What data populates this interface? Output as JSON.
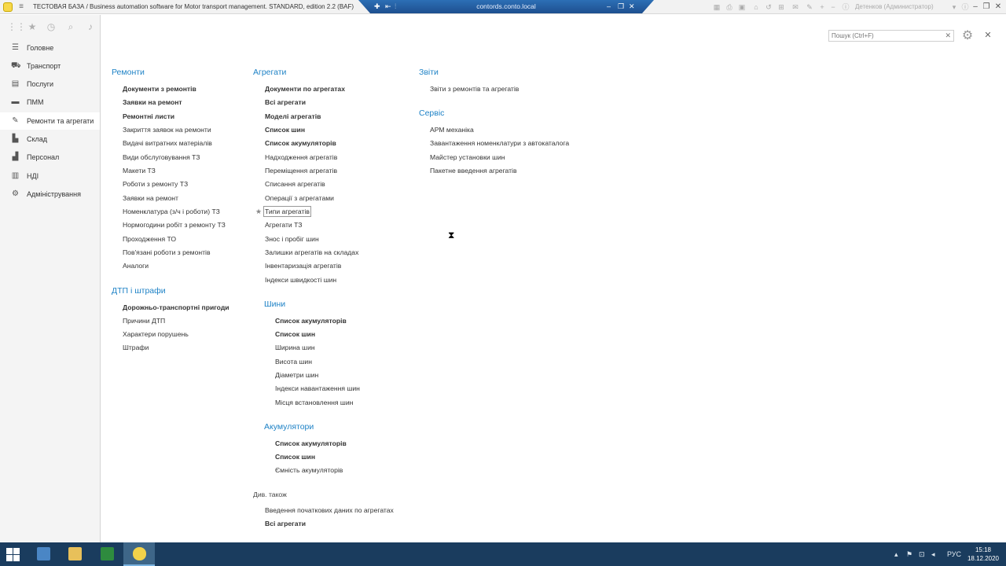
{
  "titlebar": {
    "title": "ТЕСТОВАЯ БАЗА / Business automation software for Motor transport management. STANDARD, edition 2.2  (BAF)",
    "user": "Детенков (Администратор)"
  },
  "rdp": {
    "host": "contords.conto.local"
  },
  "search": {
    "placeholder": "Пошук (Ctrl+F)",
    "value": ""
  },
  "sidebar": {
    "items": [
      {
        "label": "Головне",
        "icon": "menu-lines-icon"
      },
      {
        "label": "Транспорт",
        "icon": "truck-icon"
      },
      {
        "label": "Послуги",
        "icon": "services-icon"
      },
      {
        "label": "ПММ",
        "icon": "fuel-icon"
      },
      {
        "label": "Ремонти та агрегати",
        "icon": "wrench-icon"
      },
      {
        "label": "Склад",
        "icon": "warehouse-icon"
      },
      {
        "label": "Персонал",
        "icon": "personnel-icon"
      },
      {
        "label": "НДІ",
        "icon": "reference-icon"
      },
      {
        "label": "Адміністрування",
        "icon": "gear-icon"
      }
    ],
    "active_index": 4
  },
  "col1": {
    "repairs": {
      "title": "Ремонти",
      "items": [
        "Документи з ремонтів",
        "Заявки на ремонт",
        "Ремонтні листи",
        "Закриття заявок на ремонти",
        "Видачі витратних матеріалів",
        "Види обслуговування ТЗ",
        "Макети ТЗ",
        "Роботи з ремонту ТЗ",
        "Заявки на ремонт",
        "Номенклатура (з/ч і роботи) ТЗ",
        "Нормогодини робіт з ремонту ТЗ",
        "Проходження ТО",
        "Пов'язані роботи з ремонтів",
        "Аналоги"
      ]
    },
    "accidents": {
      "title": "ДТП і штрафи",
      "items": [
        "Дорожньо-транспортні пригоди",
        "Причини ДТП",
        "Характери порушень",
        "Штрафи"
      ]
    }
  },
  "col2": {
    "units": {
      "title": "Агрегати",
      "items": [
        "Документи по агрегатах",
        "Всі агрегати",
        "Моделі агрегатів",
        "Список шин",
        "Список акумуляторів",
        "Надходження агрегатів",
        "Переміщення агрегатів",
        "Списання агрегатів",
        "Операції з агрегатами",
        "Типи агрегатів",
        "Агрегати ТЗ",
        "Знос і пробіг шин",
        "Залишки агрегатів на складах",
        "Інвентаризація агрегатів",
        "Індекси швидкості шин"
      ]
    },
    "tires": {
      "title": "Шини",
      "items": [
        "Список акумуляторів",
        "Список шин",
        "Ширина шин",
        "Висота шин",
        "Діаметри шин",
        "Індекси навантаження шин",
        "Місця встановлення шин"
      ]
    },
    "batteries": {
      "title": "Акумулятори",
      "items": [
        "Список акумуляторів",
        "Список шин",
        "Ємність акумуляторів"
      ]
    },
    "see_also": {
      "title": "Див. також",
      "items": [
        "Введення початкових даних по агрегатах",
        "Всі агрегати"
      ]
    }
  },
  "col3": {
    "reports": {
      "title": "Звіти",
      "items": [
        "Звіти з ремонтів та агрегатів"
      ]
    },
    "service": {
      "title": "Сервіс",
      "items": [
        "АРМ механіка",
        "Завантаження номенклатури з автокаталога",
        "Майстер установки шин",
        "Пакетне введення агрегатів"
      ]
    }
  },
  "taskbar": {
    "language": "РУС",
    "time": "15:18",
    "date": "18.12.2020"
  }
}
